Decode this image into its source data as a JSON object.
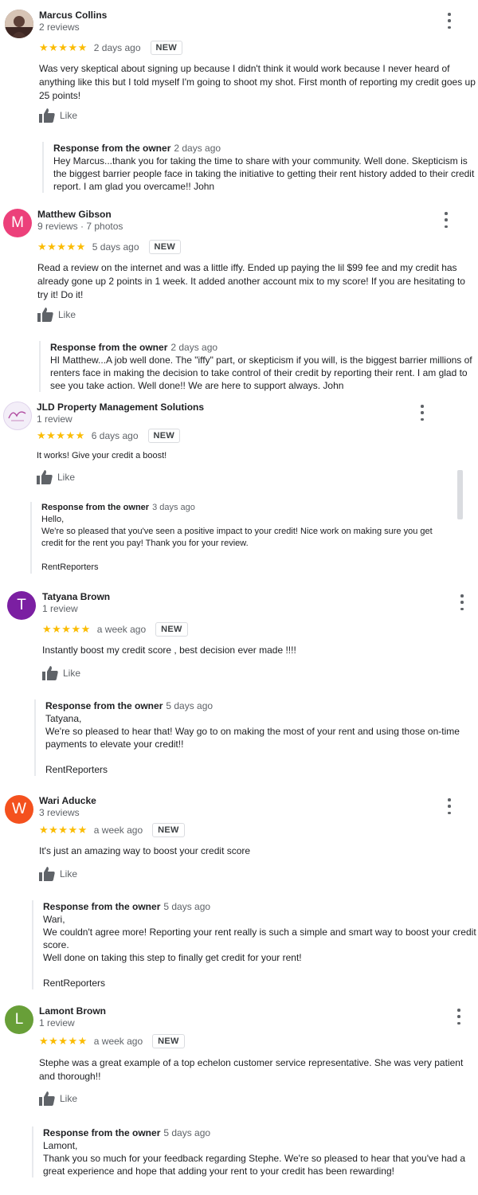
{
  "like_label": "Like",
  "reviews": [
    {
      "name": "Marcus Collins",
      "meta": "2 reviews",
      "avatar_type": "photo",
      "avatar_color": "#6d4c41",
      "stars": "★★★★★",
      "rating": 5,
      "date": "2 days ago",
      "badge": "NEW",
      "text": "Was very skeptical about signing up because I didn't think it would work because I never heard of anything like this but I told myself I'm going to shoot my shot. First month of reporting my credit goes up 25 points!",
      "response_title": "Response from the owner",
      "response_date": "2 days ago",
      "response_text": "Hey Marcus...thank you for taking the time to share with your community. Well done. Skepticism is the biggest barrier people face in taking the initiative to getting their rent history added to their credit report. I am glad you overcame!! John"
    },
    {
      "name": "Matthew Gibson",
      "meta": "9 reviews · 7 photos",
      "avatar_letter": "M",
      "avatar_color": "#ec407a",
      "stars": "★★★★★",
      "rating": 5,
      "date": "5 days ago",
      "badge": "NEW",
      "text": "Read a review on the internet and was a little iffy. Ended up paying the lil $99 fee and my credit has already gone up 2 points in 1 week. It added another account mix to my score! If you are hesitating to try it! Do it!",
      "response_title": "Response from the owner",
      "response_date": "2 days ago",
      "response_text": "HI Matthew...A job well done. The \"iffy\" part, or skepticism if you will, is the biggest barrier millions of renters face in making the decision to take control of their credit by reporting their rent. I am glad to see you take action. Well done!! We are here to support always. John"
    },
    {
      "name": "JLD Property Management Solutions",
      "meta": "1 review",
      "avatar_type": "logo",
      "avatar_color": "#f3eef8",
      "stars": "★★★★★",
      "rating": 5,
      "date": "6 days ago",
      "badge": "NEW",
      "text": "It works! Give your credit a boost!",
      "response_title": "Response from the owner",
      "response_date": "3 days ago",
      "response_text": "Hello,\nWe're so pleased that you've seen a positive impact to your credit! Nice work on making sure you get credit for the rent you pay! Thank you for your review.\n\nRentReporters"
    },
    {
      "name": "Tatyana Brown",
      "meta": "1 review",
      "avatar_letter": "T",
      "avatar_color": "#7b1fa2",
      "stars": "★★★★★",
      "rating": 5,
      "date": "a week ago",
      "badge": "NEW",
      "text": "Instantly boost my credit score , best decision ever made !!!!",
      "response_title": "Response from the owner",
      "response_date": "5 days ago",
      "response_text": "Tatyana,\nWe're so pleased to hear that! Way go to on making the most of your rent and using those on-time payments to elevate your credit!!\n\nRentReporters"
    },
    {
      "name": "Wari Aducke",
      "meta": "3 reviews",
      "avatar_letter": "W",
      "avatar_color": "#f4511e",
      "stars": "★★★★★",
      "rating": 5,
      "date": "a week ago",
      "badge": "NEW",
      "text": "It's just an amazing way to boost your credit score",
      "response_title": "Response from the owner",
      "response_date": "5 days ago",
      "response_text": "Wari,\nWe couldn't agree more! Reporting your rent really is such a simple and smart way to boost your credit score.\nWell done on taking this step to finally get credit for your rent!\n\nRentReporters"
    },
    {
      "name": "Lamont Brown",
      "meta": "1 review",
      "avatar_letter": "L",
      "avatar_color": "#689f38",
      "stars": "★★★★★",
      "rating": 5,
      "date": "a week ago",
      "badge": "NEW",
      "text": "Stephe was a great example  of a top echelon customer service  representative. She was very patient and thorough!!",
      "response_title": "Response from the owner",
      "response_date": "5 days ago",
      "response_text": "Lamont,\nThank you so much for your feedback regarding Stephe. We're so pleased to hear that you've had a great experience and hope that adding your rent to your credit has been rewarding!"
    }
  ]
}
